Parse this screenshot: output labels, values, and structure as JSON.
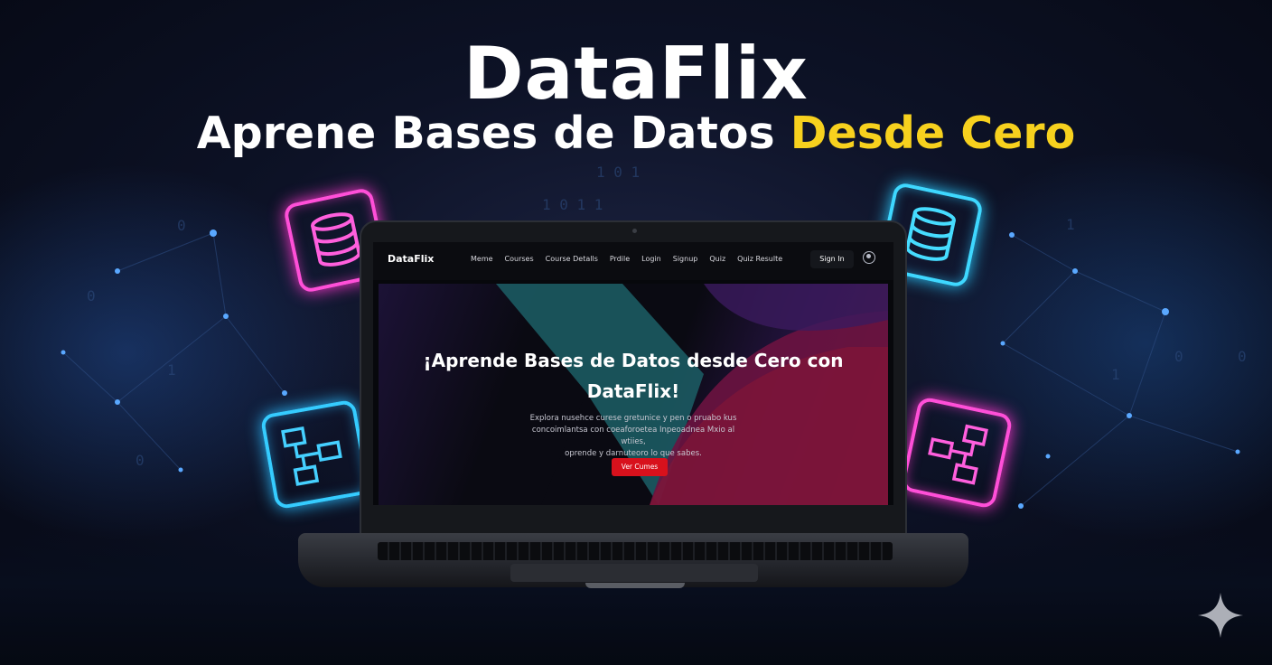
{
  "banner": {
    "title": "DataFlix",
    "subtitle_main": "Aprene Bases de Datos ",
    "subtitle_accent": "Desde Cero",
    "accent_color": "#f7d11e"
  },
  "decorations": {
    "icons": [
      "database-icon",
      "database-icon",
      "diagram-icon",
      "diagram-icon",
      "sparkle-icon"
    ],
    "colors": {
      "pink_glow": "#ff37cf",
      "cyan_glow": "#2bcaff"
    }
  },
  "site": {
    "brand": "DataFlix",
    "nav": [
      "Meme",
      "Courses",
      "Course Detalls",
      "Prdile",
      "Login",
      "Signup",
      "Quiz",
      "Quiz Resulte"
    ],
    "signin_label": "Sign In",
    "hero": {
      "title_line1": "¡Aprende Bases de Datos desde Cero con",
      "title_line2": "DataFlix!",
      "desc_line1": "Explora nusehce curese gretunice y pen o pruabo kus",
      "desc_line2": "concoimlantsa con coeaforoetea Inpeoadnea Mxio al wtiies,",
      "desc_line3": "oprende y darnuteoro lo que sabes.",
      "cta_label": "Ver Cumes",
      "cta_color": "#d8111c"
    }
  }
}
